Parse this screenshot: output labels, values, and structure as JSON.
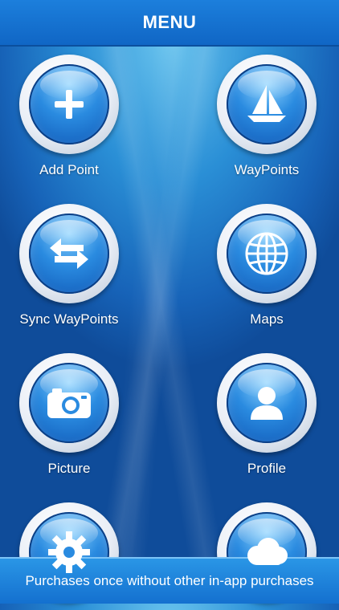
{
  "header": {
    "title": "MENU"
  },
  "menu": {
    "items": [
      {
        "label": "Add Point",
        "icon": "plus-icon"
      },
      {
        "label": "WayPoints",
        "icon": "sailboat-icon"
      },
      {
        "label": "Sync WayPoints",
        "icon": "sync-arrows-icon"
      },
      {
        "label": "Maps",
        "icon": "globe-icon"
      },
      {
        "label": "Picture",
        "icon": "camera-icon"
      },
      {
        "label": "Profile",
        "icon": "person-icon"
      },
      {
        "label": "",
        "icon": "gear-icon"
      },
      {
        "label": "",
        "icon": "cloud-icon"
      }
    ]
  },
  "footer": {
    "message": "Purchases once without other in-app purchases"
  },
  "colors": {
    "bar": "#1066c5",
    "button_blue": "#2a8be0",
    "label": "#ffffff"
  }
}
